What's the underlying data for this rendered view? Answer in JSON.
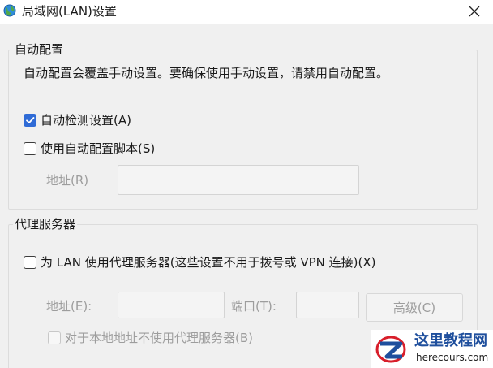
{
  "window": {
    "title": "局域网(LAN)设置",
    "close_label": "×"
  },
  "auto_config": {
    "group_title": "自动配置",
    "description": "自动配置会覆盖手动设置。要确保使用手动设置，请禁用自动配置。",
    "auto_detect": {
      "label": "自动检测设置(A)",
      "checked": true
    },
    "use_script": {
      "label": "使用自动配置脚本(S)",
      "checked": false
    },
    "address": {
      "label": "地址(R)",
      "value": ""
    }
  },
  "proxy": {
    "group_title": "代理服务器",
    "use_proxy": {
      "label": "为 LAN 使用代理服务器(这些设置不用于拨号或 VPN 连接)(X)",
      "checked": false
    },
    "address": {
      "label": "地址(E):",
      "value": ""
    },
    "port": {
      "label": "端口(T):",
      "value": ""
    },
    "advanced_button": "高级(C)",
    "bypass_local": {
      "label": "对于本地地址不使用代理服务器(B)",
      "checked": false
    }
  },
  "watermark": {
    "title": "这里教程网",
    "url": "herecours.com"
  },
  "colors": {
    "accent": "#2f6bd6",
    "disabled_text": "#9d9d9d",
    "background": "#f0f0f0"
  },
  "icons": {
    "title": "globe-network-icon",
    "close": "close-icon",
    "checkmark": "checkmark-icon"
  }
}
